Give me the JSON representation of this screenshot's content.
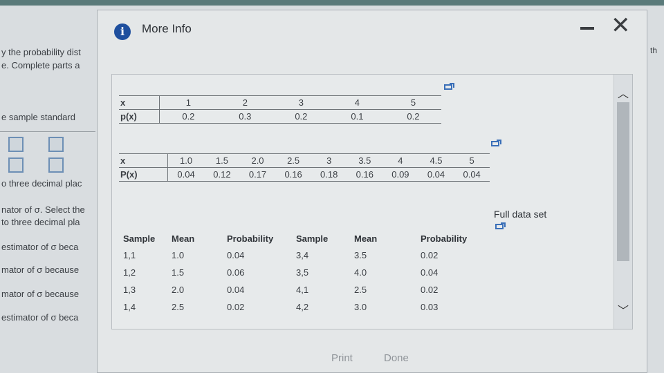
{
  "background": {
    "lines": [
      "y the probability dist",
      "e. Complete parts a",
      "e sample standard",
      "o three decimal plac",
      "nator of σ. Select the",
      "to three decimal pla",
      "estimator of σ beca",
      "mator of σ because",
      "mator of σ because",
      "estimator of σ beca"
    ],
    "right_text": "th"
  },
  "modal": {
    "title": "More Info",
    "full_data_label": "Full data set",
    "print_label": "Print",
    "done_label": "Done"
  },
  "table1": {
    "x_label": "x",
    "p_label": "p(x)",
    "x": [
      "1",
      "2",
      "3",
      "4",
      "5"
    ],
    "p": [
      "0.2",
      "0.3",
      "0.2",
      "0.1",
      "0.2"
    ]
  },
  "table2": {
    "x_label": "x",
    "p_label": "P(x)",
    "x": [
      "1.0",
      "1.5",
      "2.0",
      "2.5",
      "3",
      "3.5",
      "4",
      "4.5",
      "5"
    ],
    "p": [
      "0.04",
      "0.12",
      "0.17",
      "0.16",
      "0.18",
      "0.16",
      "0.09",
      "0.04",
      "0.04"
    ]
  },
  "sample_table": {
    "headers": [
      "Sample",
      "Mean",
      "Probability",
      "Sample",
      "Mean",
      "Probability"
    ],
    "rows": [
      [
        "1,1",
        "1.0",
        "0.04",
        "3,4",
        "3.5",
        "0.02"
      ],
      [
        "1,2",
        "1.5",
        "0.06",
        "3,5",
        "4.0",
        "0.04"
      ],
      [
        "1,3",
        "2.0",
        "0.04",
        "4,1",
        "2.5",
        "0.02"
      ],
      [
        "1,4",
        "2.5",
        "0.02",
        "4,2",
        "3.0",
        "0.03"
      ]
    ]
  }
}
